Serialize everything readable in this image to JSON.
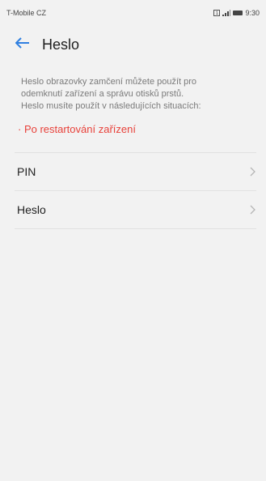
{
  "status_bar": {
    "carrier": "T-Mobile CZ",
    "sim_label": "1",
    "time": "9:30",
    "colors": {
      "text": "#444444"
    }
  },
  "header": {
    "title": "Heslo",
    "back_icon": "arrow-left-icon",
    "accent_color": "#2f7fe0"
  },
  "description": {
    "lines": [
      "Heslo obrazovky zamčení můžete použít pro",
      "odemknutí zařízení a správu otisků prstů.",
      "Heslo musíte použít v následujících situacích:"
    ]
  },
  "warning": {
    "text": "· Po restartování zařízení",
    "color": "#e8413a"
  },
  "options": [
    {
      "label": "PIN",
      "icon": "chevron-right-icon"
    },
    {
      "label": "Heslo",
      "icon": "chevron-right-icon"
    }
  ]
}
